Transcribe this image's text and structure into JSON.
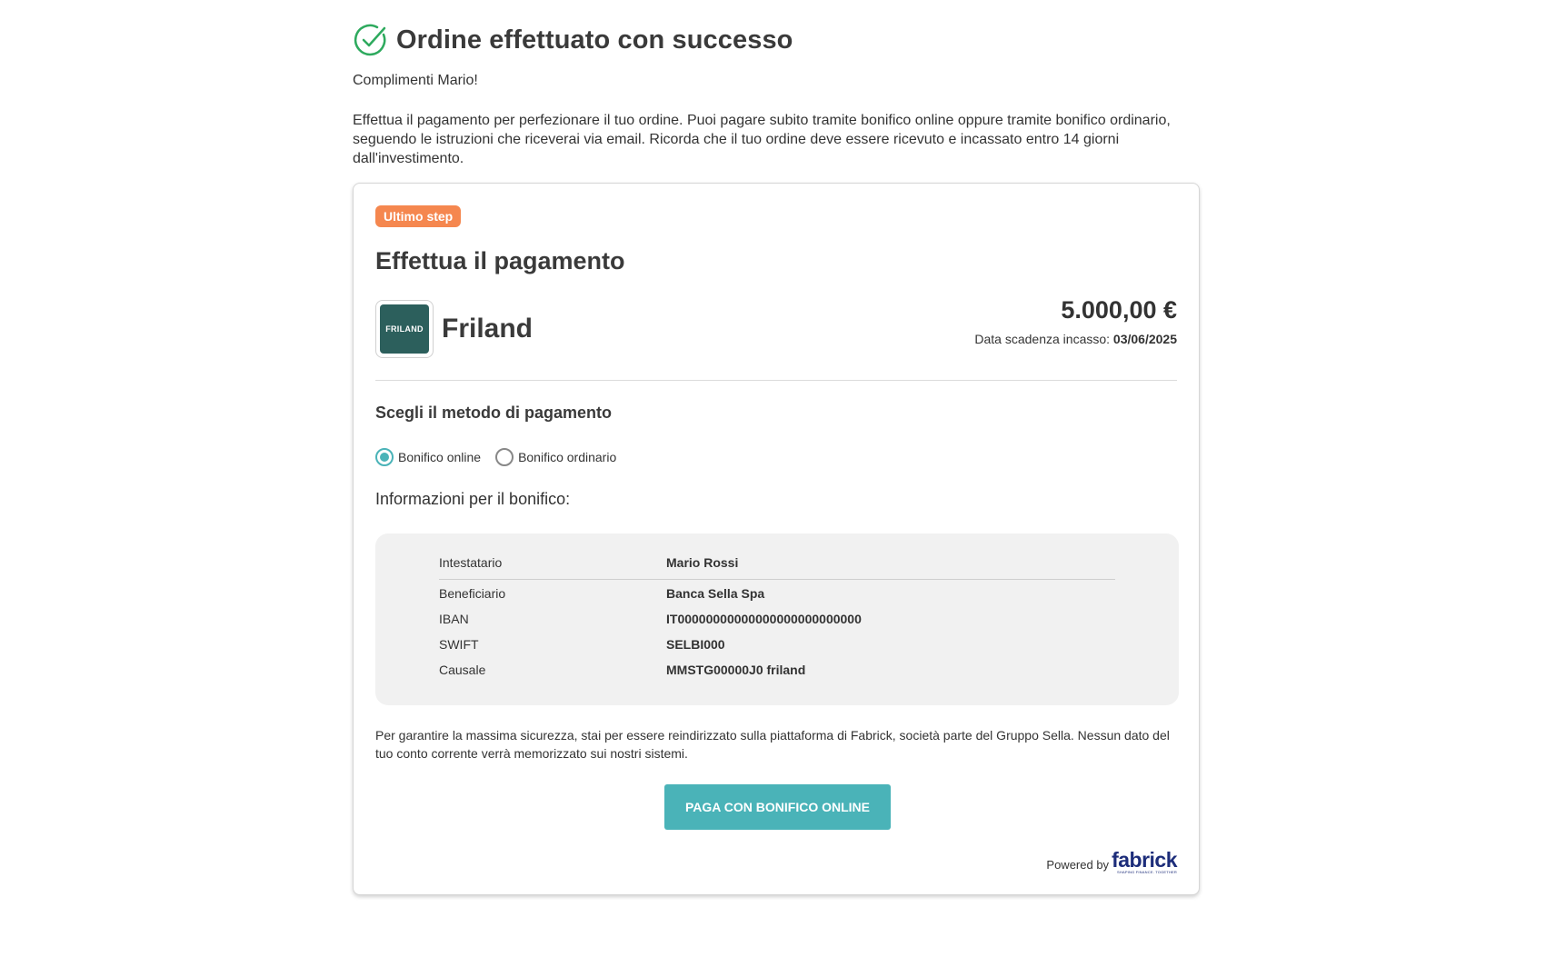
{
  "header": {
    "title": "Ordine effettuato con successo",
    "icon": "check-circle-icon",
    "icon_color": "#2eaa5e"
  },
  "greeting": "Complimenti Mario!",
  "intro": "Effettua il pagamento per perfezionare il tuo ordine. Puoi pagare subito tramite bonifico online oppure tramite bonifico ordinario, seguendo le istruzioni che riceverai via email. Ricorda che il tuo ordine deve essere ricevuto e incassato entro 14 giorni dall'investimento.",
  "card": {
    "badge": "Ultimo step",
    "badge_color": "#f5874f",
    "title": "Effettua il pagamento",
    "merchant": {
      "logo_text": "FRILAND",
      "name": "Friland"
    },
    "amount": "5.000,00 €",
    "deadline_label": "Data scadenza incasso:",
    "deadline_value": "03/06/2025",
    "method_title": "Scegli il metodo di pagamento",
    "methods": [
      {
        "label": "Bonifico online",
        "selected": true
      },
      {
        "label": "Bonifico ordinario",
        "selected": false
      }
    ],
    "info_title": "Informazioni per il bonifico:",
    "info_rows": [
      {
        "key": "Intestatario",
        "value": "Mario Rossi"
      },
      {
        "key": "Beneficiario",
        "value": "Banca Sella Spa"
      },
      {
        "key": "IBAN",
        "value": "IT00000000000000000000000000"
      },
      {
        "key": "SWIFT",
        "value": "SELBI000"
      },
      {
        "key": "Causale",
        "value": "MMSTG00000J0 friland"
      }
    ],
    "notice": "Per garantire la massima sicurezza, stai per essere reindirizzato sulla piattaforma di Fabrick, società parte del Gruppo Sella. Nessun dato del tuo conto corrente verrà memorizzato sui nostri sistemi.",
    "pay_button": "PAGA CON BONIFICO ONLINE",
    "accent_color": "#4ab3b8",
    "powered_by": "Powered by",
    "fabrick_logo": "fabrick",
    "fabrick_tagline": "SHAPING FINANCE. TOGETHER"
  }
}
